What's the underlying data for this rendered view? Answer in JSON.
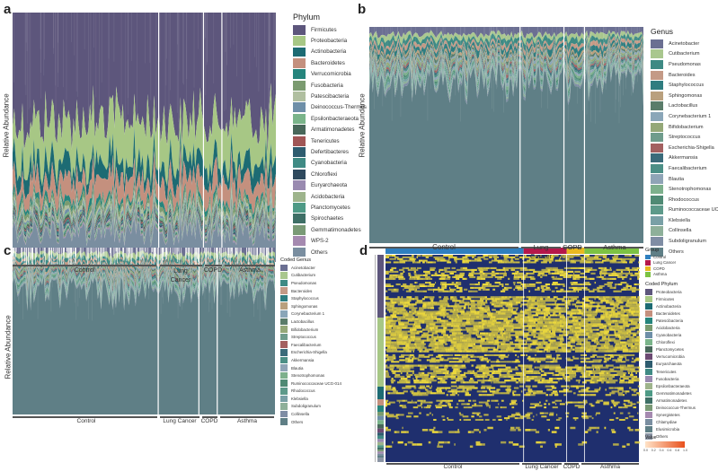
{
  "panels": {
    "a": {
      "letter": "a",
      "ylabel": "Relative Abundance",
      "legend_title": "Phylum"
    },
    "b": {
      "letter": "b",
      "ylabel": "Relative Abundance",
      "legend_title": "Genus"
    },
    "c": {
      "letter": "c",
      "ylabel": "Relative Abundance",
      "legend_title": "Coded Genus"
    },
    "d": {
      "letter": "d",
      "group_legend_title": "Group",
      "phylum_legend_title": "Coded Phylum",
      "value_legend_title": "Value"
    }
  },
  "groups": {
    "control": "Control",
    "lung_cancer_a": "Lung\nCancer",
    "lung_cancer": "Lung Cancer",
    "copd": "COPD",
    "asthma": "Asthma"
  },
  "colors": {
    "control": "#2f7fbf",
    "lung_cancer": "#b5174a",
    "copd": "#e8b820",
    "asthma": "#7cc243",
    "heat_low": "#1f2f6e",
    "heat_high": "#f0dc3c",
    "value_low": "#ffe3c8",
    "value_high": "#e8501c"
  },
  "chart_data": [
    {
      "panel": "a",
      "type": "area",
      "title": "",
      "xlabel": "",
      "ylabel": "Relative Abundance",
      "stacked": true,
      "legend": "right",
      "groups": [
        "Control",
        "Lung Cancer",
        "COPD",
        "Asthma"
      ],
      "series": [
        {
          "name": "Firmicutes",
          "color": "#5d567c"
        },
        {
          "name": "Proteobacteria",
          "color": "#a7c785"
        },
        {
          "name": "Actinobacteria",
          "color": "#1d6b73"
        },
        {
          "name": "Bacteroidetes",
          "color": "#c4907e"
        },
        {
          "name": "Verrucomicrobia",
          "color": "#26857d"
        },
        {
          "name": "Fusobacteria",
          "color": "#7b9b70"
        },
        {
          "name": "Patescibacteria",
          "color": "#b0bfa0"
        },
        {
          "name": "Deinococcus-Thermus",
          "color": "#6e8fa8"
        },
        {
          "name": "Epsilonbacteraeota",
          "color": "#7ab48a"
        },
        {
          "name": "Armatimonadetes",
          "color": "#48675a"
        },
        {
          "name": "Tenericutes",
          "color": "#a05656"
        },
        {
          "name": "Defertibacteres",
          "color": "#2e5c6f"
        },
        {
          "name": "Cyanobacteria",
          "color": "#3f8a84"
        },
        {
          "name": "Chloroflexi",
          "color": "#2f4a5e"
        },
        {
          "name": "Euryarchaeota",
          "color": "#998ab0"
        },
        {
          "name": "Acidobacteria",
          "color": "#9eb48c"
        },
        {
          "name": "Planctomycetes",
          "color": "#4e9a86"
        },
        {
          "name": "Spirochaetes",
          "color": "#3e6f66"
        },
        {
          "name": "Gemmatimonadetes",
          "color": "#7a9a76"
        },
        {
          "name": "WPS-2",
          "color": "#a58ab0"
        },
        {
          "name": "Others",
          "color": "#7a8ea0"
        }
      ]
    },
    {
      "panel": "b",
      "type": "area",
      "title": "",
      "xlabel": "",
      "ylabel": "Relative Abundance",
      "stacked": true,
      "legend": "right",
      "groups": [
        "Control",
        "Lung Cancer",
        "COPD",
        "Asthma"
      ],
      "series": [
        {
          "name": "Acinetobacter",
          "color": "#6b6f92"
        },
        {
          "name": "Cutibacterium",
          "color": "#a9c78e"
        },
        {
          "name": "Pseudomonas",
          "color": "#3e8a84"
        },
        {
          "name": "Bacteroides",
          "color": "#c49a86"
        },
        {
          "name": "Staphylococcus",
          "color": "#2f7d80"
        },
        {
          "name": "Sphingomonas",
          "color": "#b9a07e"
        },
        {
          "name": "Lactobacillus",
          "color": "#5a7c6a"
        },
        {
          "name": "Corynebacterium 1",
          "color": "#8aa6b8"
        },
        {
          "name": "Bifidobacterium",
          "color": "#94a878"
        },
        {
          "name": "Streptococcus",
          "color": "#6f9c8c"
        },
        {
          "name": "Escherichia-Shigella",
          "color": "#a36060"
        },
        {
          "name": "Akkermansia",
          "color": "#3b6b7a"
        },
        {
          "name": "Faecalibacterium",
          "color": "#4c8f86"
        },
        {
          "name": "Blautia",
          "color": "#8fa4b6"
        },
        {
          "name": "Stenotrophomonas",
          "color": "#7db08c"
        },
        {
          "name": "Rhodococcus",
          "color": "#4f8a74"
        },
        {
          "name": "Ruminococcaceae UCG-014",
          "color": "#5d9a8a"
        },
        {
          "name": "Klebsiella",
          "color": "#79a0a6"
        },
        {
          "name": "Collinsella",
          "color": "#8eb09a"
        },
        {
          "name": "Subdoligranulum",
          "color": "#7f8da4"
        },
        {
          "name": "Others",
          "color": "#5f7f86"
        }
      ]
    },
    {
      "panel": "c",
      "type": "area",
      "title": "",
      "xlabel": "",
      "ylabel": "Relative Abundance",
      "stacked": true,
      "legend": "right",
      "groups": [
        "Control",
        "Lung Cancer",
        "COPD",
        "Asthma"
      ],
      "series": [
        {
          "name": "Acinetobacter",
          "color": "#6b6f92"
        },
        {
          "name": "Cutibacterium",
          "color": "#a9c78e"
        },
        {
          "name": "Pseudomonas",
          "color": "#3e8a84"
        },
        {
          "name": "Bacteroides",
          "color": "#c49a86"
        },
        {
          "name": "Staphylococcus",
          "color": "#2f7d80"
        },
        {
          "name": "Sphingomonas",
          "color": "#b9a07e"
        },
        {
          "name": "Corynebacterium 1",
          "color": "#8aa6b8"
        },
        {
          "name": "Lactobacillus",
          "color": "#5a7c6a"
        },
        {
          "name": "Bifidobacterium",
          "color": "#94a878"
        },
        {
          "name": "Streptococcus",
          "color": "#6f9c8c"
        },
        {
          "name": "Faecalibacterium",
          "color": "#a36060"
        },
        {
          "name": "Escherichia-Shigella",
          "color": "#3b6b7a"
        },
        {
          "name": "Akkermansia",
          "color": "#4c8f86"
        },
        {
          "name": "Blautia",
          "color": "#8fa4b6"
        },
        {
          "name": "Stenotrophomonas",
          "color": "#7db08c"
        },
        {
          "name": "Ruminococcaceae UCG-014",
          "color": "#4f8a74"
        },
        {
          "name": "Rhodococcus",
          "color": "#5d9a8a"
        },
        {
          "name": "Klebsiella",
          "color": "#79a0a6"
        },
        {
          "name": "Subdoligranulum",
          "color": "#8eb09a"
        },
        {
          "name": "Collinsella",
          "color": "#7f8da4"
        },
        {
          "name": "Others",
          "color": "#5f7f86"
        }
      ]
    },
    {
      "panel": "d",
      "type": "heatmap",
      "title": "",
      "legend": "right",
      "groups": [
        "Control",
        "Lung Cancer",
        "COPD",
        "Asthma"
      ],
      "group_legend": [
        "Control",
        "Lung Cancer",
        "COPD",
        "Asthma"
      ],
      "phyla": [
        {
          "name": "Proteobacteria",
          "color": "#5d567c"
        },
        {
          "name": "Firmicutes",
          "color": "#a7c785"
        },
        {
          "name": "Actinobacteria",
          "color": "#1d6b73"
        },
        {
          "name": "Bacteroidetes",
          "color": "#c4907e"
        },
        {
          "name": "Patescibacteria",
          "color": "#26857d"
        },
        {
          "name": "Acidobacteria",
          "color": "#7b9b70"
        },
        {
          "name": "Cyanobacteria",
          "color": "#6e8fa8"
        },
        {
          "name": "Chloroflexi",
          "color": "#7ab48a"
        },
        {
          "name": "Planctomycetes",
          "color": "#48675a"
        },
        {
          "name": "Verrucomicrobia",
          "color": "#6b4a72"
        },
        {
          "name": "Euryarchaeota",
          "color": "#2e5c6f"
        },
        {
          "name": "Tenericutes",
          "color": "#3f8a84"
        },
        {
          "name": "Fusobacteria",
          "color": "#998ab0"
        },
        {
          "name": "Epsilonbacteraeota",
          "color": "#9eb48c"
        },
        {
          "name": "Gemmatimonadetes",
          "color": "#4e9a86"
        },
        {
          "name": "Armatimonadetes",
          "color": "#3e6f66"
        },
        {
          "name": "Deinococcus-Thermus",
          "color": "#7a9a76"
        },
        {
          "name": "Synergistetes",
          "color": "#a58ab0"
        },
        {
          "name": "Chlamydiae",
          "color": "#7a8ea0"
        },
        {
          "name": "Elusimicrobia",
          "color": "#5f7f86"
        },
        {
          "name": "Others",
          "color": "#8a94a4"
        }
      ],
      "value_legend": {
        "title": "Value",
        "ticks": [
          "0.0",
          "0.2",
          "0.4",
          "0.6",
          "0.8",
          "1.0"
        ],
        "range": [
          0,
          1
        ]
      }
    }
  ]
}
